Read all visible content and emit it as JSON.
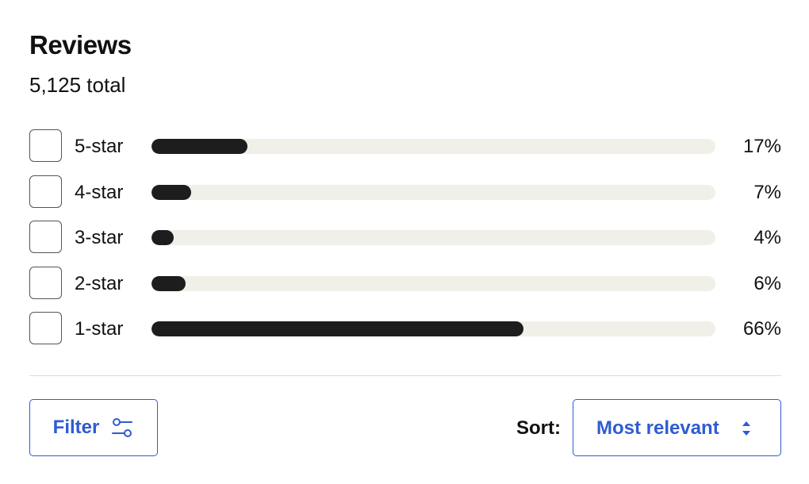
{
  "header": {
    "title": "Reviews",
    "total": "5,125 total"
  },
  "ratings": [
    {
      "label": "5-star",
      "percent_text": "17%",
      "percent": 17
    },
    {
      "label": "4-star",
      "percent_text": "7%",
      "percent": 7
    },
    {
      "label": "3-star",
      "percent_text": "4%",
      "percent": 4
    },
    {
      "label": "2-star",
      "percent_text": "6%",
      "percent": 6
    },
    {
      "label": "1-star",
      "percent_text": "66%",
      "percent": 66
    }
  ],
  "controls": {
    "filter_label": "Filter",
    "filter_icon": "sliders-icon",
    "sort_label": "Sort:",
    "sort_value": "Most relevant",
    "sort_icon": "up-down-chevron-icon"
  },
  "colors": {
    "accent": "#2f5bd3",
    "bar_fill": "#1d1d1d",
    "bar_track": "#f0efe8"
  }
}
